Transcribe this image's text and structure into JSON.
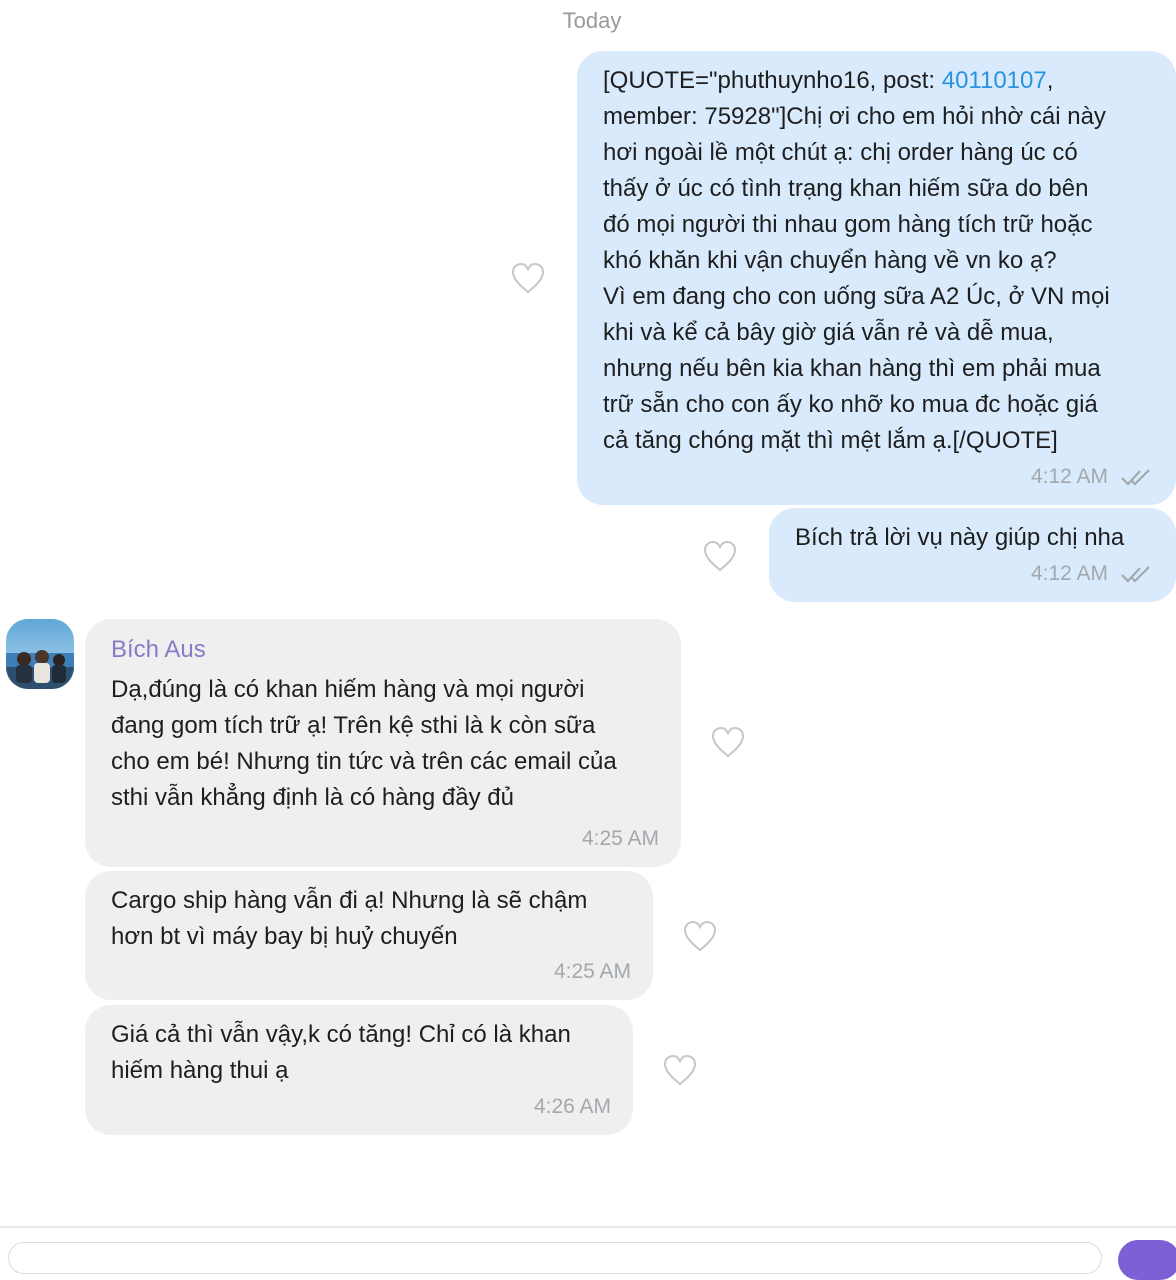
{
  "chat": {
    "date_separator": "Today",
    "messages": [
      {
        "direction": "outgoing",
        "text_before_link": "[QUOTE=\"phuthuynho16, post: ",
        "link": "40110107",
        "text_after_link": ",\nmember: 75928\"]Chị ơi cho em hỏi nhờ cái này\nhơi ngoài lề một chút ạ: chị order hàng úc có\nthấy ở úc có tình trạng khan hiếm sữa do bên\nđó mọi người thi nhau gom hàng tích trữ hoặc\nkhó khăn khi vận chuyển hàng về vn ko ạ?\nVì em đang cho con uống sữa A2 Úc, ở VN mọi\nkhi và kể cả bây giờ giá vẫn rẻ và dễ mua,\nnhưng nếu bên kia khan hàng thì em phải mua\ntrữ sẵn cho con ấy ko nhỡ ko mua đc hoặc giá\ncả tăng chóng mặt thì mệt lắm ạ.[/QUOTE]",
        "time": "4:12 AM",
        "status_icon": "double-check-icon"
      },
      {
        "direction": "outgoing",
        "text": "Bích trả lời vụ này giúp chị nha",
        "time": "4:12 AM",
        "status_icon": "double-check-icon"
      },
      {
        "direction": "incoming",
        "sender": "Bích Aus",
        "text": "Dạ,đúng là có khan hiếm hàng và mọi người\nđang gom tích trữ ạ! Trên kệ sthi là k còn sữa\ncho em bé! Nhưng tin tức và trên các email của\nsthi vẫn khẳng định là có hàng đầy đủ",
        "time": "4:25 AM"
      },
      {
        "direction": "incoming",
        "text": "Cargo ship hàng vẫn đi ạ! Nhưng là sẽ chậm\nhơn bt vì máy bay bị huỷ chuyến",
        "time": "4:25 AM"
      },
      {
        "direction": "incoming",
        "text": "Giá cả thì vẫn vậy,k có tăng! Chỉ có là khan\nhiếm hàng thui ạ",
        "time": "4:26 AM"
      }
    ]
  },
  "colors": {
    "outgoing_bubble": "#d9eafc",
    "incoming_bubble": "#efefef",
    "link": "#2a93e0",
    "sender_name": "#8a78c8",
    "meta_text": "#a3a8ad",
    "send_button": "#7d5fd6"
  },
  "icons": {
    "reaction": "heart-outline-icon",
    "read_receipt": "double-check-icon"
  }
}
